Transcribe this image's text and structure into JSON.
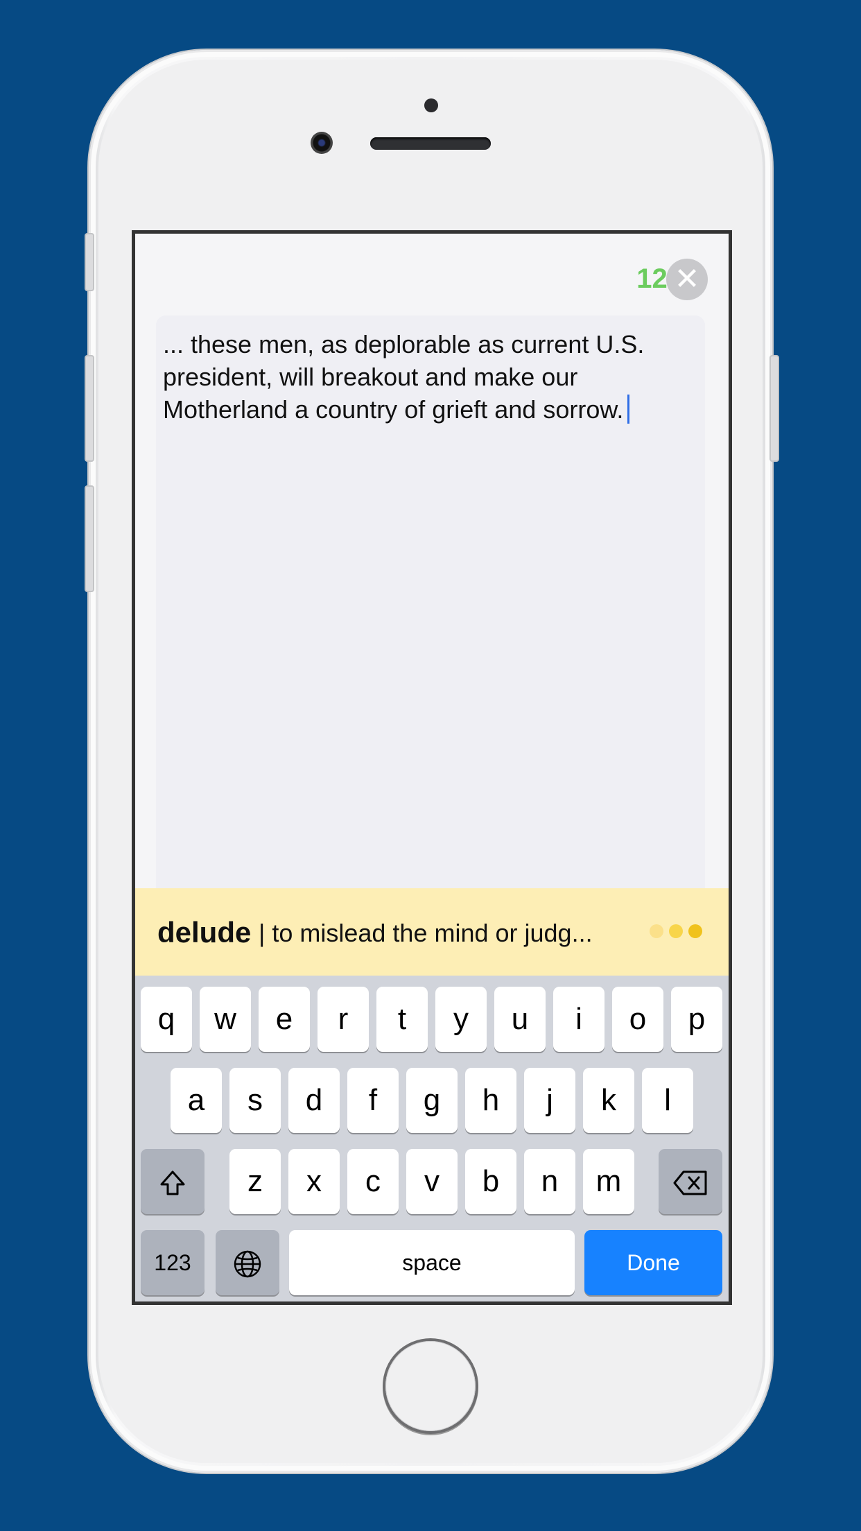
{
  "editor": {
    "counter": "124",
    "text": "... these men, as deplorable as current U.S. president, will breakout and make our Motherland a country of grieft and sorrow."
  },
  "suggestion": {
    "word": "delude",
    "definition": "| to mislead the mind or judg...",
    "dot_colors": [
      "#fbe08a",
      "#f8d54a",
      "#f0c21c"
    ]
  },
  "keyboard": {
    "row1": [
      "q",
      "w",
      "e",
      "r",
      "t",
      "y",
      "u",
      "i",
      "o",
      "p"
    ],
    "row2": [
      "a",
      "s",
      "d",
      "f",
      "g",
      "h",
      "j",
      "k",
      "l"
    ],
    "row3": [
      "z",
      "x",
      "c",
      "v",
      "b",
      "n",
      "m"
    ],
    "numbers_label": "123",
    "space_label": "space",
    "done_label": "Done"
  },
  "icons": {
    "close": "close-icon",
    "shift": "shift-icon",
    "delete": "backspace-icon",
    "globe": "globe-icon"
  },
  "colors": {
    "background": "#064a84",
    "counter": "#6ccc5e",
    "done": "#1782ff",
    "suggestion_bar": "#fdeeb5"
  }
}
